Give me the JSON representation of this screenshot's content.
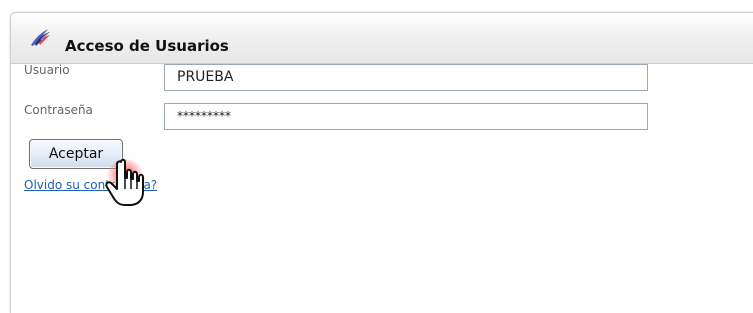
{
  "panel": {
    "title": "Acceso de Usuarios"
  },
  "form": {
    "usuario_label": "Usuario",
    "usuario_value": "PRUEBA",
    "contrasena_label": "Contraseña",
    "contrasena_value": "*********",
    "accept_label": "Aceptar",
    "forgot_link": "Olvido su contraseña?"
  },
  "icons": {
    "header": "feather-icon",
    "cursor": "hand-pointer-icon"
  },
  "colors": {
    "link": "#1f5fb8",
    "accent_red": "#ff4a4a"
  }
}
